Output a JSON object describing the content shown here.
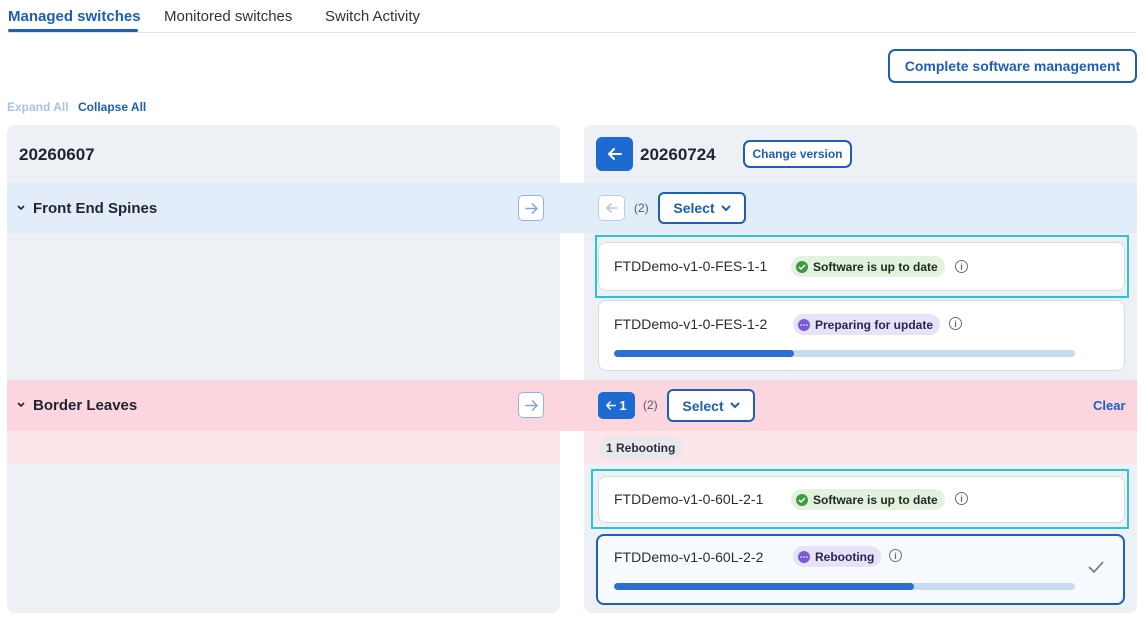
{
  "tabs": [
    {
      "label": "Managed switches",
      "active": true
    },
    {
      "label": "Monitored switches",
      "active": false
    },
    {
      "label": "Switch Activity",
      "active": false
    }
  ],
  "actions": {
    "complete_software_management": "Complete software management",
    "expand_all": "Expand All",
    "collapse_all": "Collapse All"
  },
  "left_panel": {
    "version": "20260607",
    "groups": [
      {
        "label": "Front End Spines"
      },
      {
        "label": "Border Leaves"
      }
    ]
  },
  "right_panel": {
    "version": "20260724",
    "change_version_label": "Change version",
    "groups": [
      {
        "count": "(2)",
        "select_label": "Select",
        "devices": [
          {
            "name": "FTDDemo-v1-0-FES-1-1",
            "status": "Software is up to date",
            "status_type": "success"
          },
          {
            "name": "FTDDemo-v1-0-FES-1-2",
            "status": "Preparing for update",
            "status_type": "progress",
            "progress": 0.39
          }
        ]
      },
      {
        "back_count": "1",
        "count": "(2)",
        "select_label": "Select",
        "clear_label": "Clear",
        "chip": "1 Rebooting",
        "devices": [
          {
            "name": "FTDDemo-v1-0-60L-2-1",
            "status": "Software is up to date",
            "status_type": "success"
          },
          {
            "name": "FTDDemo-v1-0-60L-2-2",
            "status": "Rebooting",
            "status_type": "progress",
            "progress": 0.65,
            "selected": true
          }
        ]
      }
    ]
  },
  "colors": {
    "primary": "#1d5fb8",
    "success": "#3c9b3c",
    "progress": "#7a5bd6",
    "highlight": "#2ec1dc",
    "group_blue": "#e3edf9",
    "group_pink": "#fbd6de"
  }
}
